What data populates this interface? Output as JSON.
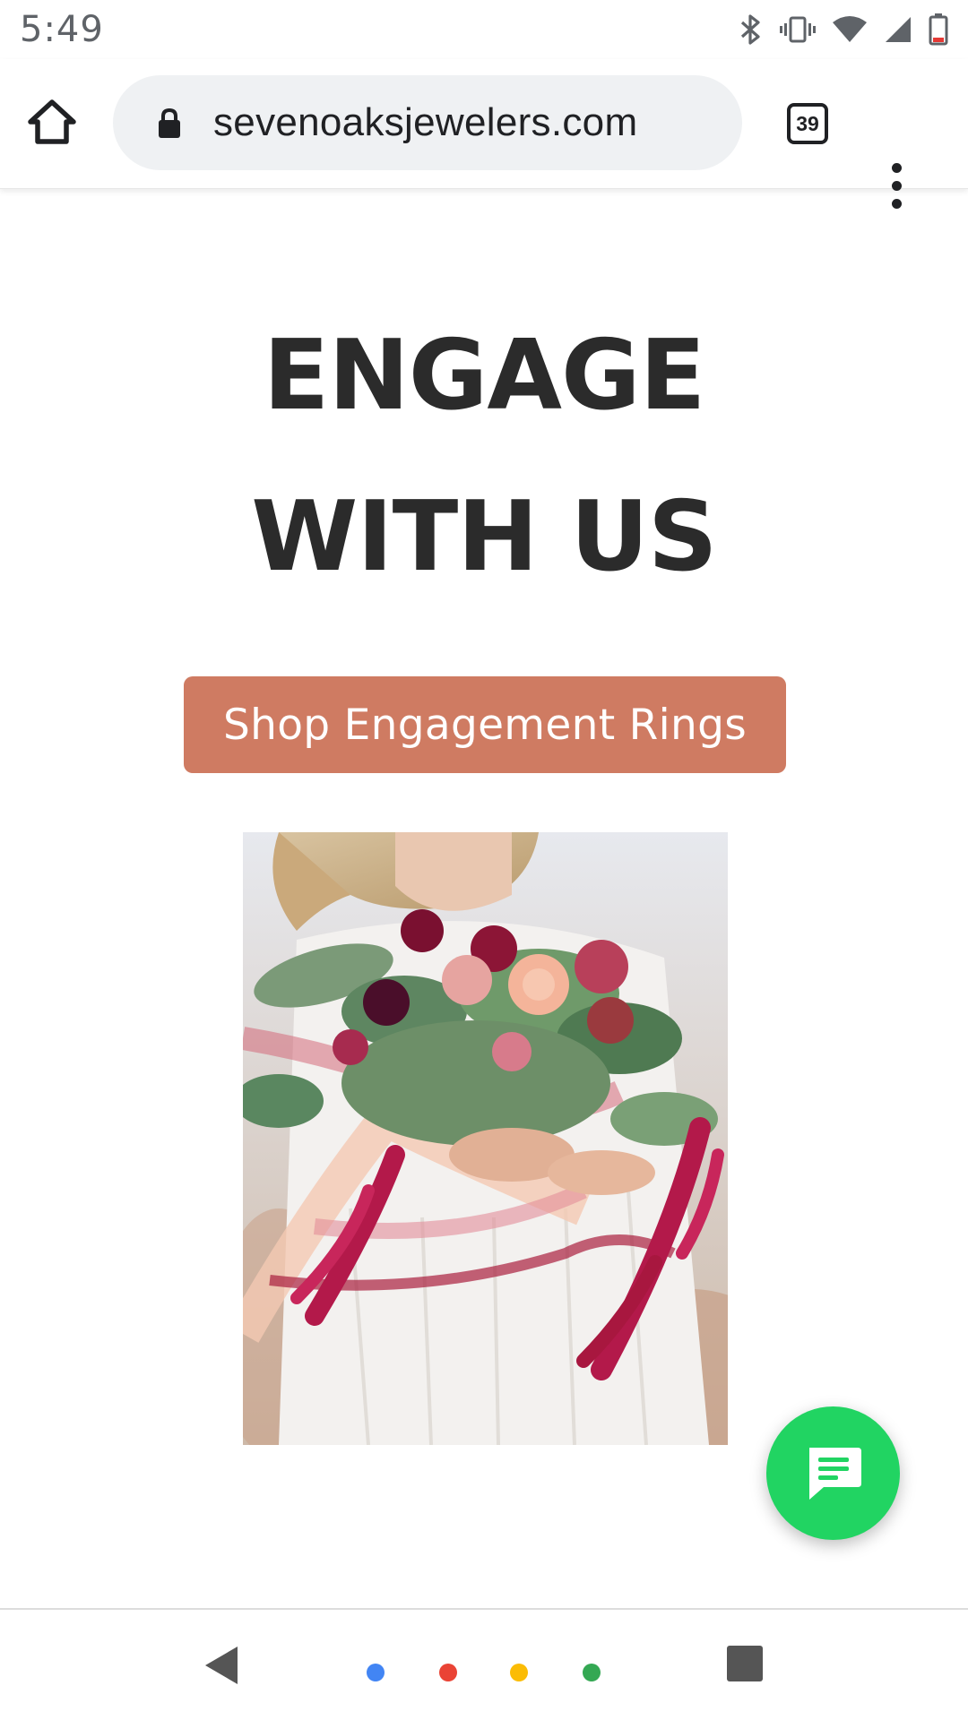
{
  "status_bar": {
    "time": "5:49",
    "icons": [
      "bluetooth-icon",
      "vibrate-icon",
      "wifi-icon",
      "signal-icon",
      "battery-icon"
    ]
  },
  "browser": {
    "url": "sevenoaksjewelers.com",
    "tab_count": "39",
    "icons": [
      "home-icon",
      "lock-icon",
      "tabs-icon",
      "more-menu-icon"
    ]
  },
  "page": {
    "headline_line1": "ENGAGE",
    "headline_line2": "WITH US",
    "cta_label": "Shop Engagement Rings",
    "cta_color": "#cf7b62",
    "hero_image_description": "bride holding bouquet",
    "chat_button_color": "#21d462"
  },
  "nav_bar": {
    "icons": [
      "back-icon",
      "assistant-dots-icon",
      "recents-icon"
    ],
    "dot_colors": [
      "#4285f4",
      "#ea4335",
      "#fbbc05",
      "#34a853"
    ]
  }
}
